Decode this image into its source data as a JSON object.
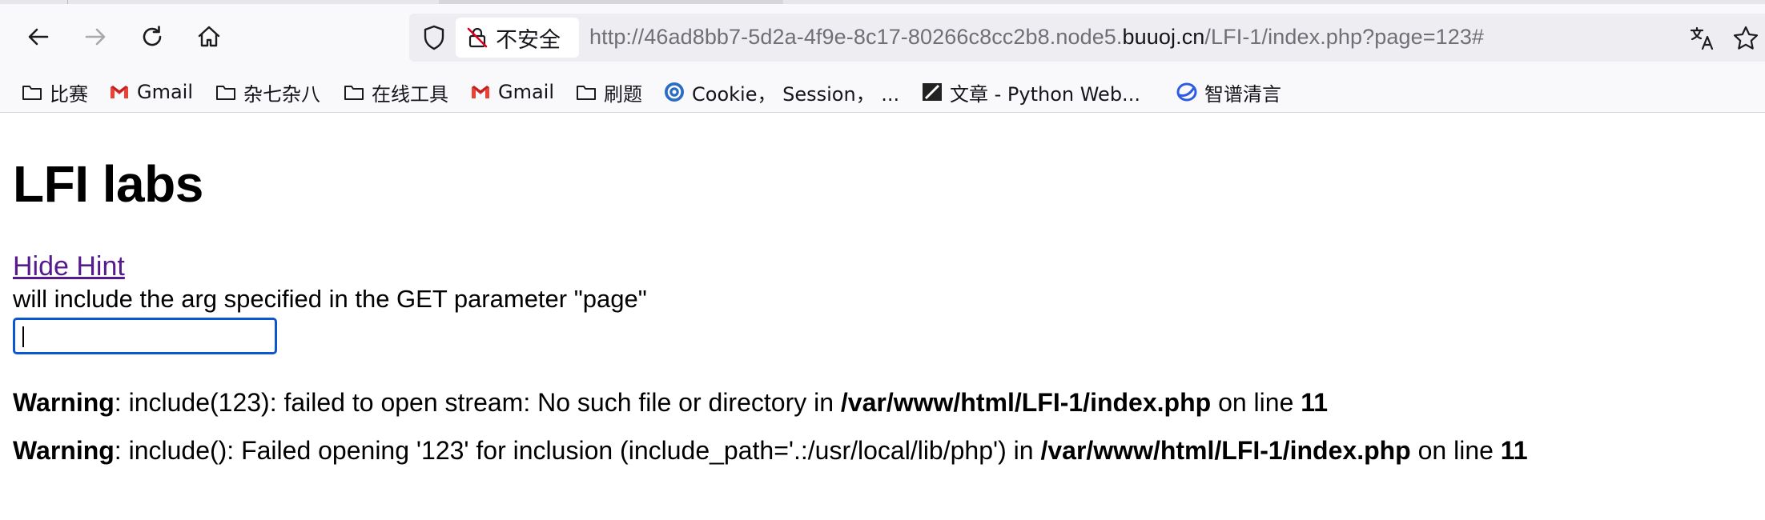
{
  "browser": {
    "nav": {
      "back_icon": "arrow-left-icon",
      "forward_icon": "arrow-right-icon",
      "reload_icon": "reload-icon",
      "home_icon": "home-icon"
    },
    "urlbar": {
      "security_label": "不安全",
      "url_prefix": "http://46ad8bb7-5d2a-4f9e-8c17-80266c8cc2b8.node5.",
      "url_domain": "buuoj.cn",
      "url_suffix": "/LFI-1/index.php?page=123#",
      "translate_icon": "translate-icon",
      "bookmark_star_icon": "star-icon"
    },
    "bookmarks": [
      {
        "label": "比赛",
        "icon": "folder-icon"
      },
      {
        "label": "Gmail",
        "icon": "gmail-icon"
      },
      {
        "label": "杂七杂八",
        "icon": "folder-icon"
      },
      {
        "label": "在线工具",
        "icon": "folder-icon"
      },
      {
        "label": "Gmail",
        "icon": "gmail-icon"
      },
      {
        "label": "刷题",
        "icon": "folder-icon"
      },
      {
        "label": "Cookie， Session， ...",
        "icon": "site-icon"
      },
      {
        "label": "文章 - Python Web...",
        "icon": "zhihu-icon"
      },
      {
        "label": "智谱清言",
        "icon": "chatglm-icon"
      }
    ],
    "colors": {
      "visited_link": "#551a8b",
      "focus_ring": "#0b57d0",
      "urlbar_bg": "#eeeef2"
    }
  },
  "page": {
    "title": "LFI labs",
    "hint_link": "Hide Hint",
    "hint_text": "will include the arg specified in the GET parameter \"page\"",
    "input_value": "",
    "warnings": [
      {
        "label": "Warning",
        "message": ": include(123): failed to open stream: No such file or directory in ",
        "file": "/var/www/html/LFI-1/index.php",
        "line_text": " on line ",
        "line": "11"
      },
      {
        "label": "Warning",
        "message": ": include(): Failed opening '123' for inclusion (include_path='.:/usr/local/lib/php') in ",
        "file": "/var/www/html/LFI-1/index.php",
        "line_text": " on line ",
        "line": "11"
      }
    ]
  }
}
